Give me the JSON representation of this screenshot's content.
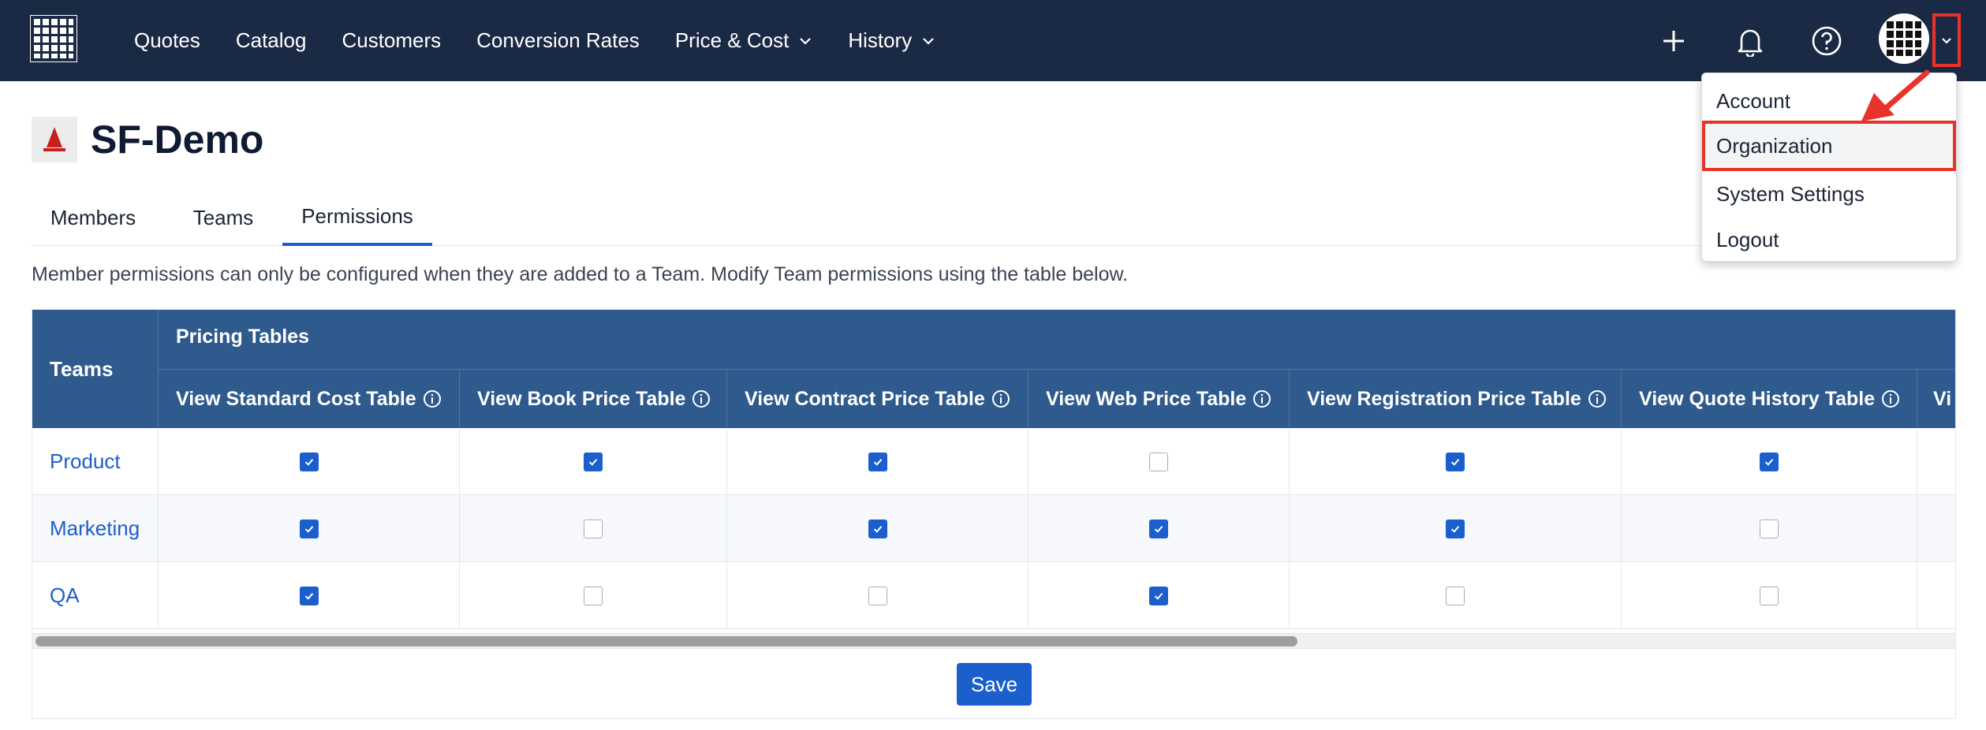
{
  "nav": {
    "items": [
      {
        "label": "Quotes",
        "has_dropdown": false
      },
      {
        "label": "Catalog",
        "has_dropdown": false
      },
      {
        "label": "Customers",
        "has_dropdown": false
      },
      {
        "label": "Conversion Rates",
        "has_dropdown": false
      },
      {
        "label": "Price & Cost",
        "has_dropdown": true
      },
      {
        "label": "History",
        "has_dropdown": true
      }
    ],
    "icons": [
      "plus-icon",
      "bell-icon",
      "help-icon"
    ]
  },
  "user_menu": {
    "items": [
      {
        "label": "Account",
        "highlighted": false
      },
      {
        "label": "Organization",
        "highlighted": true
      },
      {
        "label": "System Settings",
        "highlighted": false
      },
      {
        "label": "Logout",
        "highlighted": false
      }
    ]
  },
  "org": {
    "name": "SF-Demo"
  },
  "tabs": [
    {
      "label": "Members",
      "active": false
    },
    {
      "label": "Teams",
      "active": false
    },
    {
      "label": "Permissions",
      "active": true
    }
  ],
  "notice": "Member permissions can only be configured when they are added to a Team. Modify Team permissions using the table below.",
  "table": {
    "teams_header": "Teams",
    "group_header": "Pricing Tables",
    "columns": [
      "View Standard Cost Table",
      "View Book Price Table",
      "View Contract Price Table",
      "View Web Price Table",
      "View Registration Price Table",
      "View Quote History Table",
      "Vi"
    ],
    "rows": [
      {
        "team": "Product",
        "checks": [
          true,
          true,
          true,
          false,
          true,
          true
        ]
      },
      {
        "team": "Marketing",
        "checks": [
          true,
          false,
          true,
          true,
          true,
          false
        ]
      },
      {
        "team": "QA",
        "checks": [
          true,
          false,
          false,
          true,
          false,
          false
        ]
      }
    ]
  },
  "save_label": "Save",
  "colors": {
    "navbar": "#1b2a44",
    "table_header": "#2e5a8d",
    "accent": "#1b5fcc",
    "highlight": "#e8332a"
  }
}
